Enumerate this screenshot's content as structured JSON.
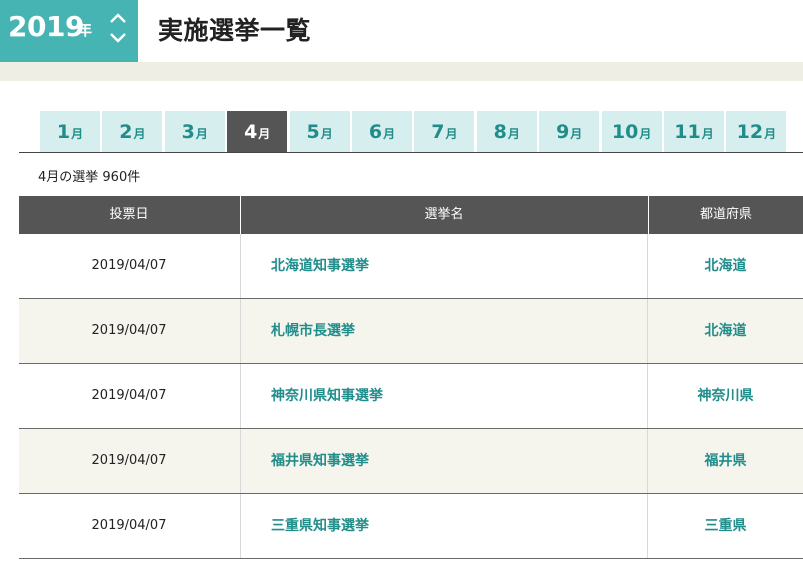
{
  "header": {
    "year": "2019",
    "year_unit": "年",
    "title": "実施選挙一覧"
  },
  "tabs": [
    {
      "num": "1",
      "unit": "月"
    },
    {
      "num": "2",
      "unit": "月"
    },
    {
      "num": "3",
      "unit": "月"
    },
    {
      "num": "4",
      "unit": "月"
    },
    {
      "num": "5",
      "unit": "月"
    },
    {
      "num": "6",
      "unit": "月"
    },
    {
      "num": "7",
      "unit": "月"
    },
    {
      "num": "8",
      "unit": "月"
    },
    {
      "num": "9",
      "unit": "月"
    },
    {
      "num": "10",
      "unit": "月"
    },
    {
      "num": "11",
      "unit": "月"
    },
    {
      "num": "12",
      "unit": "月"
    }
  ],
  "active_tab": "4",
  "count_text": "4月の選挙 960件",
  "table": {
    "headers": [
      "投票日",
      "選挙名",
      "都道府県"
    ],
    "rows": [
      {
        "date": "2019/04/07",
        "name": "北海道知事選挙",
        "pref": "北海道"
      },
      {
        "date": "2019/04/07",
        "name": "札幌市長選挙",
        "pref": "北海道"
      },
      {
        "date": "2019/04/07",
        "name": "神奈川県知事選挙",
        "pref": "神奈川県"
      },
      {
        "date": "2019/04/07",
        "name": "福井県知事選挙",
        "pref": "福井県"
      },
      {
        "date": "2019/04/07",
        "name": "三重県知事選挙",
        "pref": "三重県"
      }
    ]
  },
  "colors": {
    "accent": "#46b4b2",
    "link": "#218d8b",
    "tab_bg": "#d6eeed",
    "tab_active": "#555555",
    "header_band": "#efeee4"
  }
}
